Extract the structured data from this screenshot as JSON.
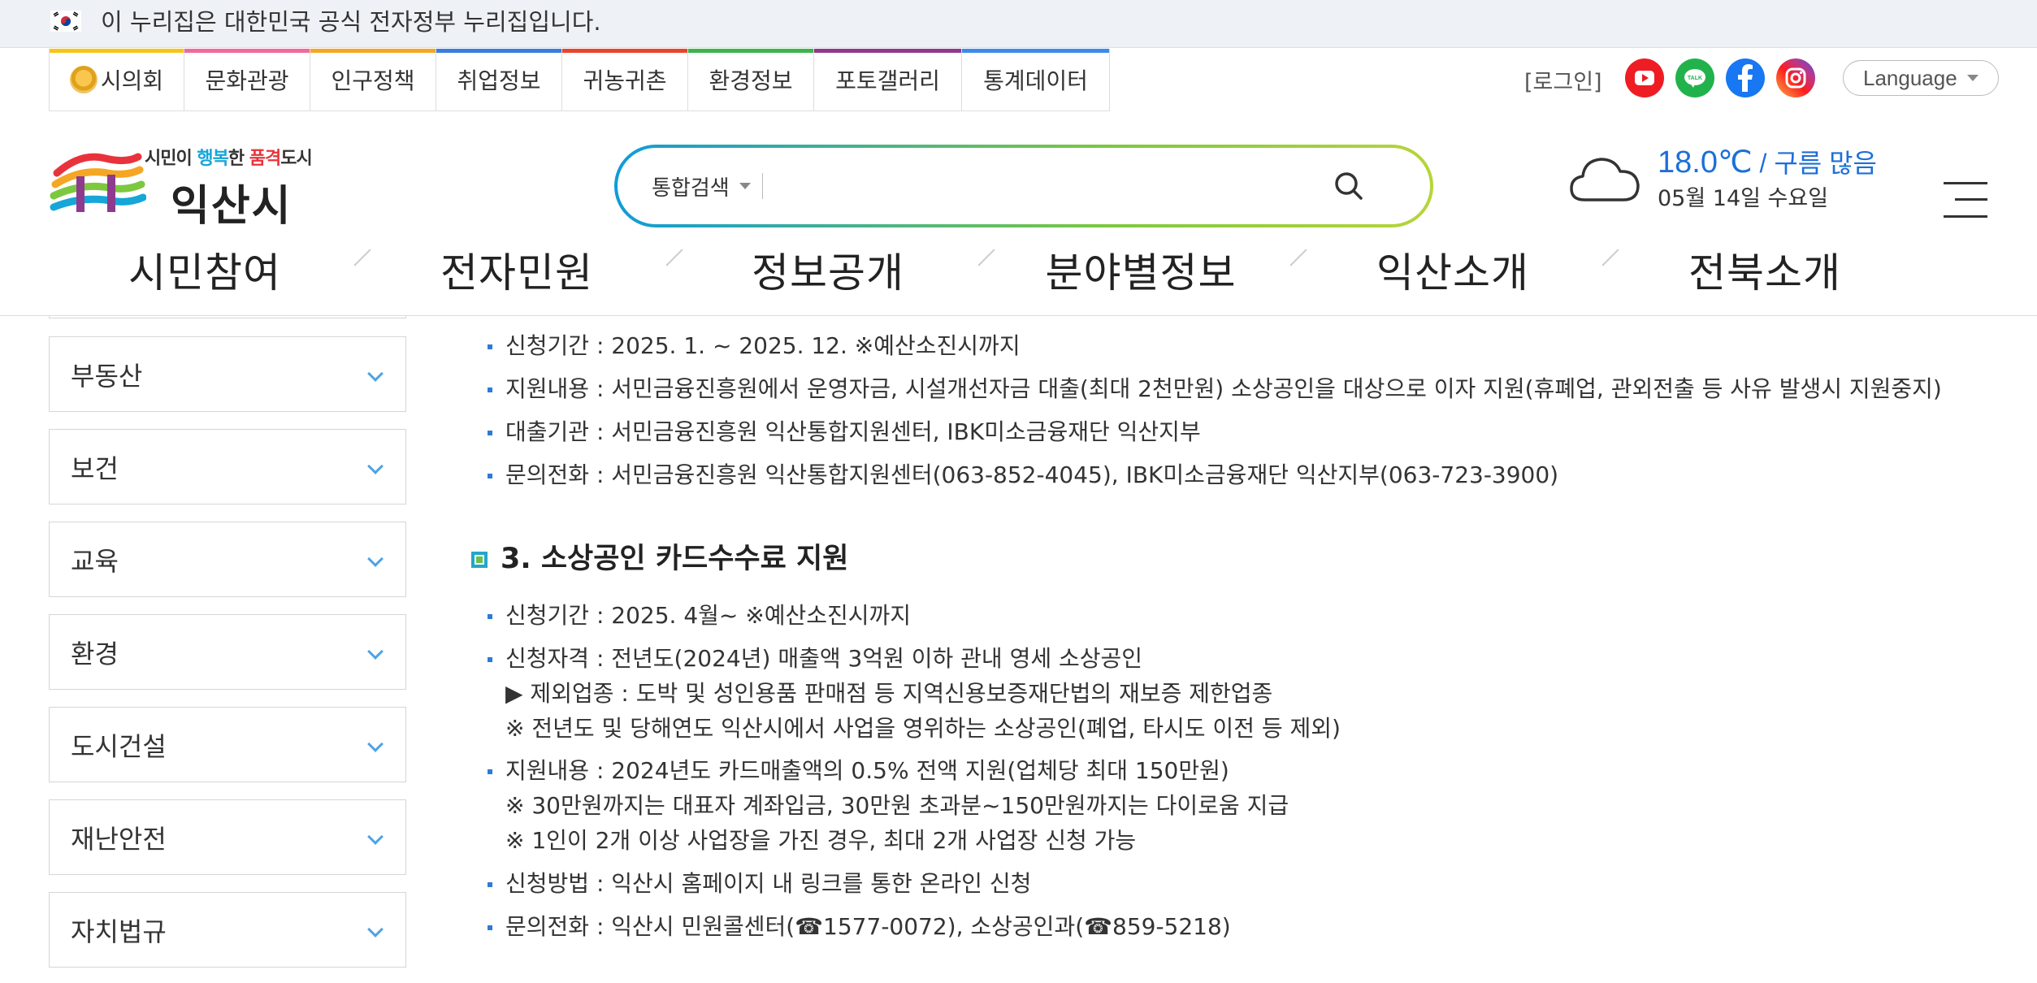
{
  "gov_banner": {
    "text": "이 누리집은 대한민국 공식 전자정부 누리집입니다."
  },
  "site_tabs": [
    {
      "label": "시의회",
      "color": "#f5c518"
    },
    {
      "label": "문화관광",
      "color": "#f06a9b"
    },
    {
      "label": "인구정책",
      "color": "#f5a623"
    },
    {
      "label": "취업정보",
      "color": "#3b7ddd"
    },
    {
      "label": "귀농귀촌",
      "color": "#e8452c"
    },
    {
      "label": "환경정보",
      "color": "#3cb44b"
    },
    {
      "label": "포토갤러리",
      "color": "#8e3a8e"
    },
    {
      "label": "통계데이터",
      "color": "#3d8be8"
    }
  ],
  "utility": {
    "login": "[로그인]",
    "language": "Language"
  },
  "sns": [
    "youtube-icon",
    "line-icon",
    "facebook-icon",
    "instagram-icon"
  ],
  "logo": {
    "slogan_a": "시민이 ",
    "slogan_b": "행복",
    "slogan_c": "한 ",
    "slogan_d": "품격",
    "slogan_e": "도시",
    "name": "익산시"
  },
  "search": {
    "scope": "통합검색",
    "placeholder": ""
  },
  "weather": {
    "temp": "18.0℃",
    "sep": " / ",
    "condition": "구름 많음",
    "date": "05월 14일 수요일"
  },
  "gnb": [
    "시민참여",
    "전자민원",
    "정보공개",
    "분야별정보",
    "익산소개",
    "전북소개"
  ],
  "sidebar": [
    "부동산",
    "보건",
    "교육",
    "환경",
    "도시건설",
    "재난안전",
    "자치법규"
  ],
  "content": {
    "section2": [
      "신청기간 : 2025. 1. ~ 2025. 12. ※예산소진시까지",
      "지원내용 : 서민금융진흥원에서 운영자금, 시설개선자금 대출(최대 2천만원) 소상공인을 대상으로 이자 지원(휴폐업, 관외전출 등 사유 발생시 지원중지)",
      "대출기관 : 서민금융진흥원 익산통합지원센터, IBK미소금융재단 익산지부",
      "문의전화 : 서민금융진흥원 익산통합지원센터(063-852-4045), IBK미소금융재단 익산지부(063-723-3900)"
    ],
    "heading3": "3. 소상공인 카드수수료 지원",
    "section3": [
      "신청기간 : 2025. 4월~ ※예산소진시까지",
      "신청자격 : 전년도(2024년) 매출액 3억원 이하 관내 영세 소상공인",
      "▶ 제외업종 : 도박 및 성인용품 판매점 등 지역신용보증재단법의 재보증 제한업종",
      "※ 전년도 및 당해연도 익산시에서 사업을 영위하는 소상공인(폐업, 타시도 이전 등 제외)",
      "지원내용 : 2024년도 카드매출액의 0.5% 전액 지원(업체당 최대 150만원)",
      "※ 30만원까지는 대표자 계좌입금, 30만원 초과분~150만원까지는 다이로움 지급",
      "※ 1인이 2개 이상 사업장을 가진 경우, 최대 2개 사업장 신청 가능",
      "신청방법 : 익산시 홈페이지 내 링크를 통한 온라인 신청",
      "문의전화 : 익산시 민원콜센터(☎1577-0072), 소상공인과(☎859-5218)"
    ]
  }
}
